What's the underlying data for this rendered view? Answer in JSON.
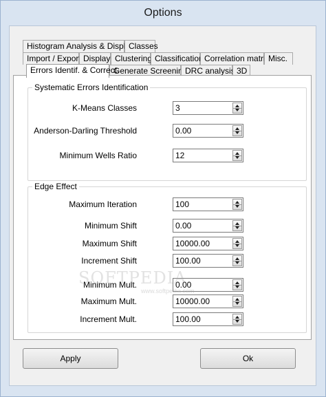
{
  "window": {
    "title": "Options"
  },
  "tabs": {
    "row1": [
      "Histogram Analysis & Display",
      "Classes"
    ],
    "row2": [
      "Import / Export",
      "Display",
      "Clustering",
      "Classification",
      "Correlation matrix",
      "Misc."
    ],
    "row3": [
      "Errors Identif. & Correct.",
      "Generate Screening",
      "DRC analysis",
      "3D"
    ],
    "active": "Errors Identif. & Correct."
  },
  "systematic": {
    "title": "Systematic Errors Identification",
    "fields": [
      {
        "label": "K-Means Classes",
        "value": "3"
      },
      {
        "label": "Anderson-Darling Threshold",
        "value": "0.00"
      },
      {
        "label": "Minimum Wells Ratio",
        "value": "12"
      }
    ]
  },
  "edge": {
    "title": "Edge Effect",
    "fields": [
      {
        "label": "Maximum Iteration",
        "value": "100"
      },
      {
        "label": "Minimum Shift",
        "value": "0.00"
      },
      {
        "label": "Maximum Shift",
        "value": "10000.00"
      },
      {
        "label": "Increment Shift",
        "value": "100.00"
      },
      {
        "label": "Minimum Mult.",
        "value": "0.00"
      },
      {
        "label": "Maximum Mult.",
        "value": "10000.00"
      },
      {
        "label": "Increment Mult.",
        "value": "100.00"
      }
    ]
  },
  "buttons": {
    "apply": "Apply",
    "ok": "Ok"
  },
  "watermark": {
    "main": "SOFTPEDIA",
    "sub": "www.softpedia.com"
  }
}
